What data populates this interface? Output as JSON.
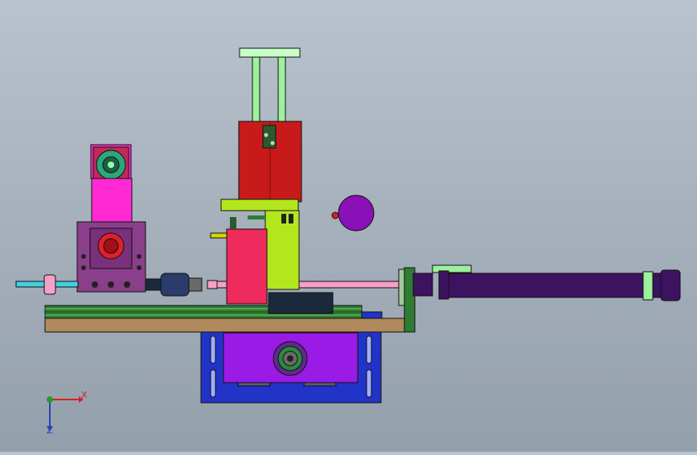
{
  "viewport": {
    "background_top": "#b9c3cd",
    "background_bottom": "#939fab"
  },
  "model": {
    "colors": {
      "base_plate": "#b08a5c",
      "rail": "#2e7d32",
      "motor_housing": "#8a3f8a",
      "motor_mount": "#ff2ad4",
      "red_column": "#c81a1a",
      "red_block": "#ee2b5c",
      "lime_bracket": "#b4e61e",
      "guide_rods": "#9cf29c",
      "cylinder": "#3d1260",
      "pink_rod": "#f5a0c8",
      "lower_frame": "#2233c8",
      "lower_motor": "#9a1ae6",
      "knob": "#8a10b8"
    },
    "icons": [
      "shaft-coupling-icon",
      "bolt-icon",
      "gear-icon"
    ]
  },
  "triad": {
    "x_label": "X",
    "z_label": "Z",
    "x_color": "#d62020",
    "y_color": "#20a020",
    "z_color": "#2a3fb8"
  }
}
